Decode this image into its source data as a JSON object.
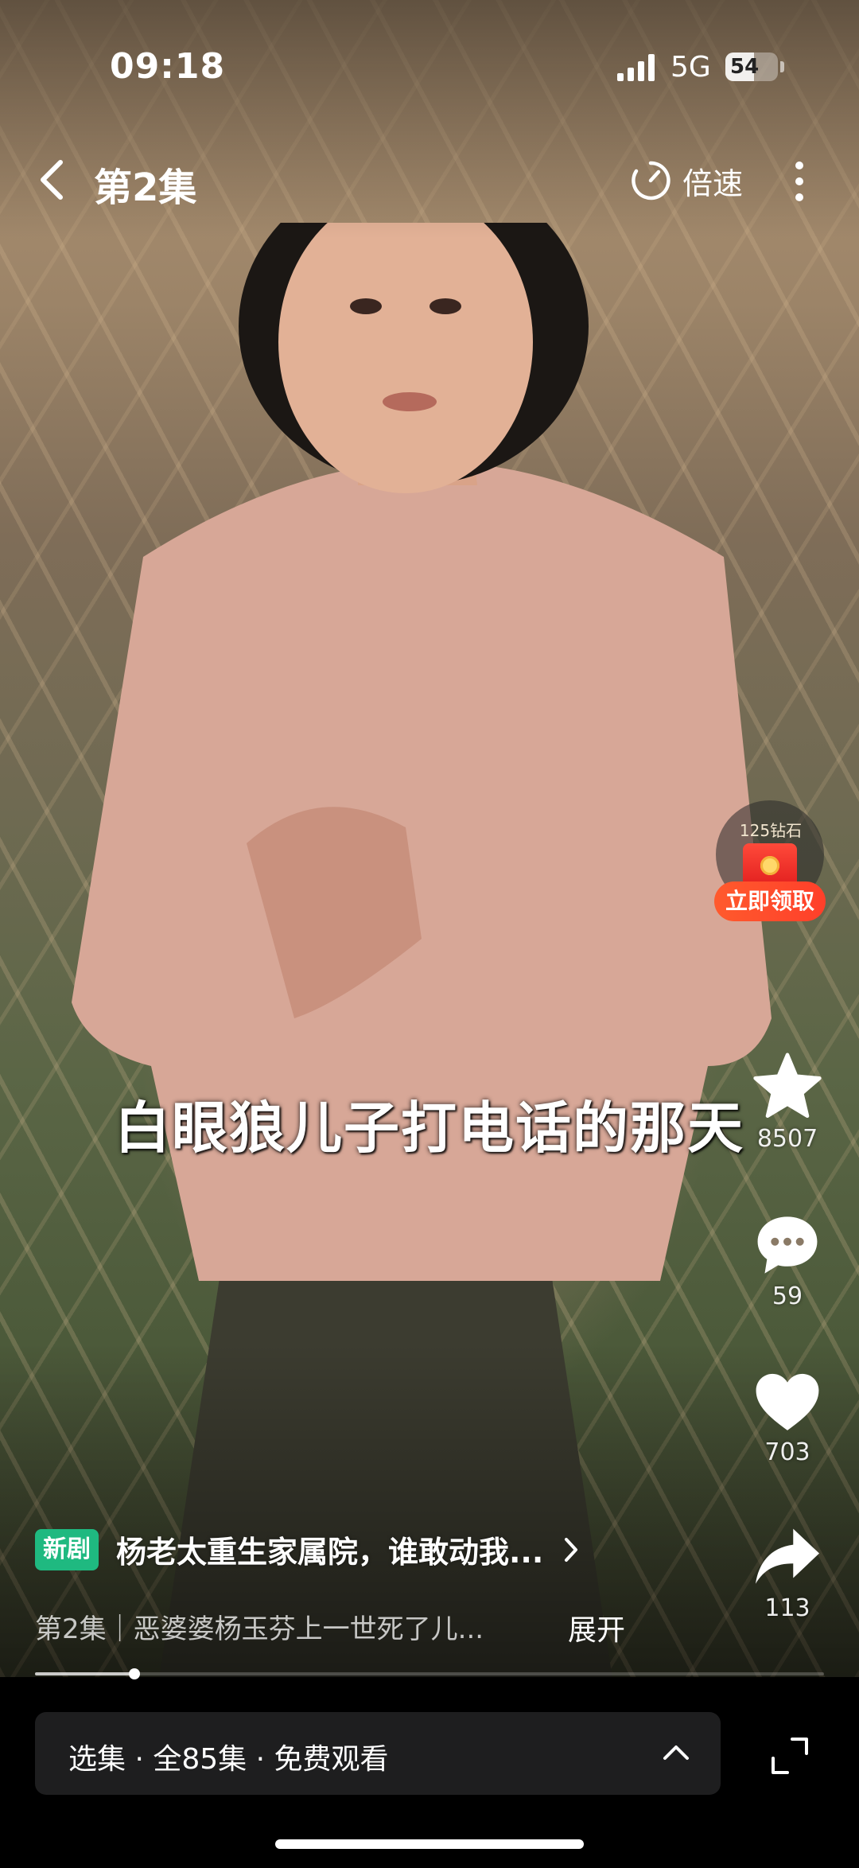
{
  "status_bar": {
    "time": "09:18",
    "network": "5G",
    "battery_level": "54",
    "battery_fraction": 0.54
  },
  "nav": {
    "episode_title": "第2集",
    "speed_label": "倍速",
    "icons": {
      "back": "back-icon",
      "speed": "speed-dial-icon",
      "more": "more-vertical-icon"
    }
  },
  "video": {
    "subtitle": "白眼狼儿子打电话的那天",
    "progress_fraction": 0.126
  },
  "reward": {
    "amount": "125钻石",
    "claim_label": "立即领取"
  },
  "actions": {
    "collect_count": "8507",
    "comment_count": "59",
    "like_count": "703",
    "share_count": "113",
    "icons": [
      "star-icon",
      "comment-icon",
      "heart-icon",
      "share-icon"
    ]
  },
  "drama": {
    "badge": "新剧",
    "title": "杨老太重生家属院，谁敢动我...",
    "description": "第2集｜恶婆婆杨玉芬上一世死了儿...",
    "expand_label": "展开"
  },
  "bottom_bar": {
    "episodes_label": "选集 · 全85集 · 免费观看"
  },
  "colors": {
    "badge_green": "#1fb980",
    "claim_orange": "#ff4a2a",
    "bar_dark": "#1e1e1f"
  }
}
